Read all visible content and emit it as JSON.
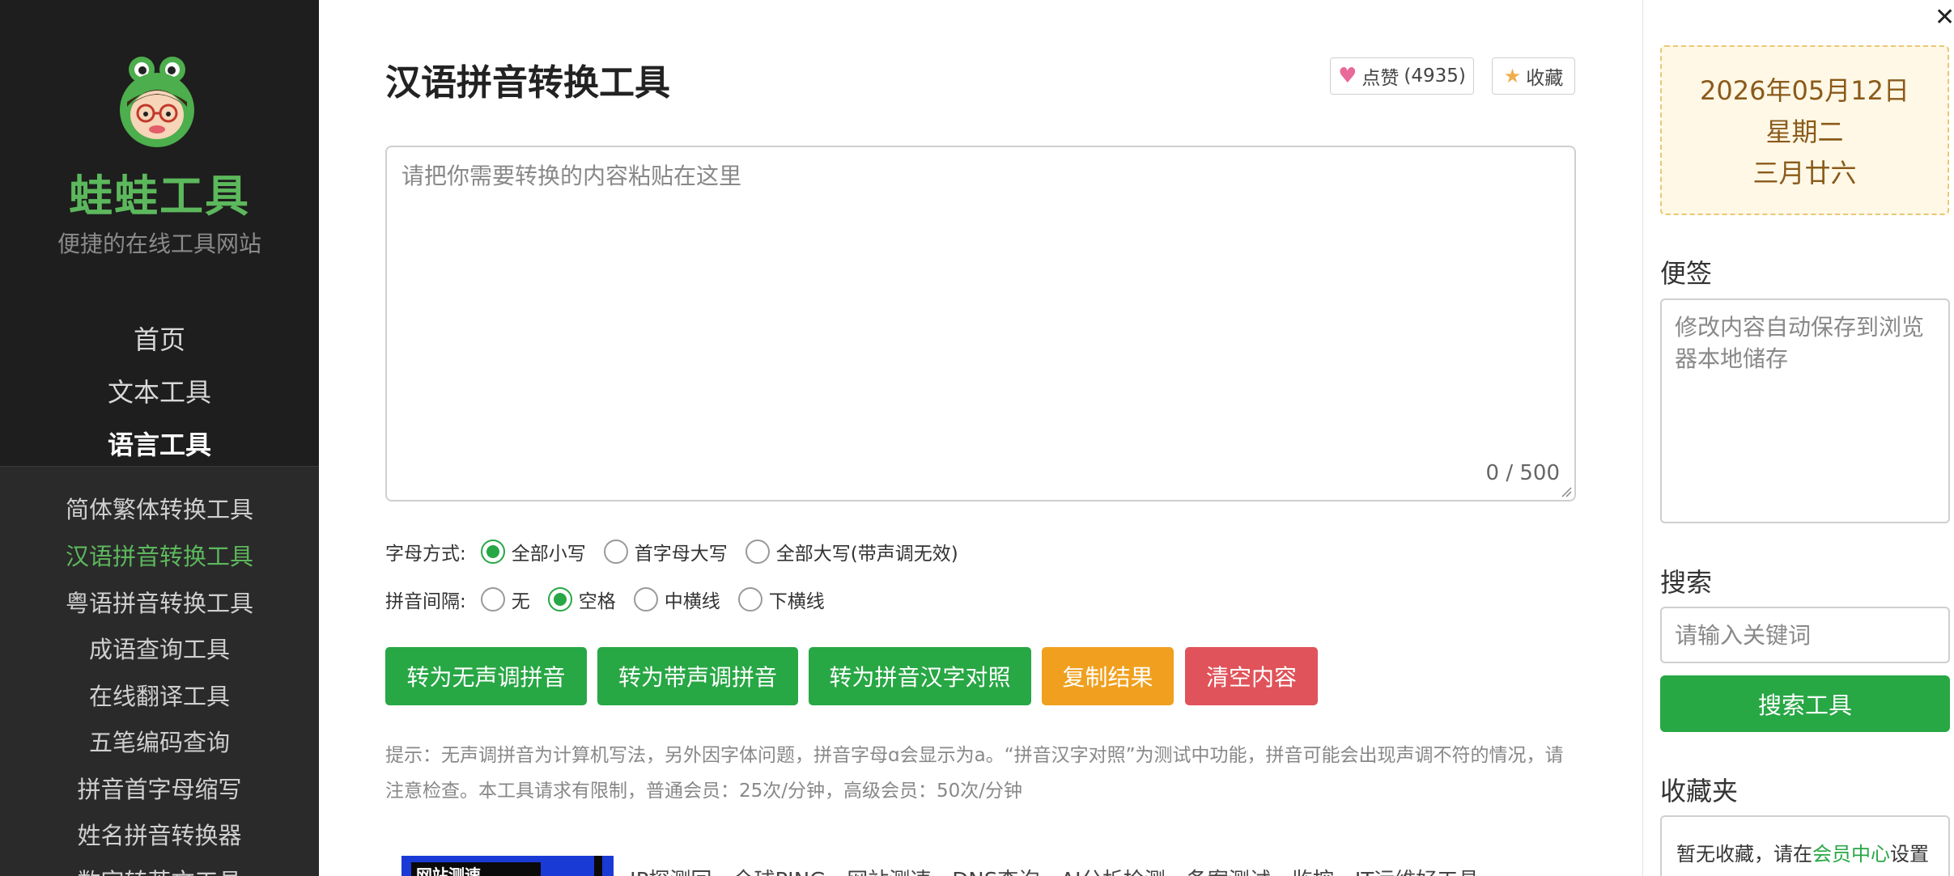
{
  "sidebar": {
    "brand": "蛙蛙工具",
    "slogan": "便捷的在线工具网站",
    "nav": [
      {
        "label": "首页"
      },
      {
        "label": "文本工具"
      },
      {
        "label": "语言工具"
      }
    ],
    "subnav": [
      {
        "label": "简体繁体转换工具"
      },
      {
        "label": "汉语拼音转换工具"
      },
      {
        "label": "粤语拼音转换工具"
      },
      {
        "label": "成语查询工具"
      },
      {
        "label": "在线翻译工具"
      },
      {
        "label": "五笔编码查询"
      },
      {
        "label": "拼音首字母缩写"
      },
      {
        "label": "姓名拼音转换器"
      },
      {
        "label": "数字转英文工具"
      }
    ]
  },
  "main": {
    "title": "汉语拼音转换工具",
    "like": {
      "label": "点赞",
      "count": "(4935)"
    },
    "favorite": {
      "label": "收藏"
    },
    "input": {
      "placeholder": "请把你需要转换的内容粘贴在这里",
      "counter": "0 / 500"
    },
    "letter_mode": {
      "label": "字母方式:",
      "options": [
        {
          "label": "全部小写",
          "checked": true
        },
        {
          "label": "首字母大写",
          "checked": false
        },
        {
          "label": "全部大写(带声调无效)",
          "checked": false
        }
      ]
    },
    "spacing": {
      "label": "拼音间隔:",
      "options": [
        {
          "label": "无",
          "checked": false
        },
        {
          "label": "空格",
          "checked": true
        },
        {
          "label": "中横线",
          "checked": false
        },
        {
          "label": "下横线",
          "checked": false
        }
      ]
    },
    "buttons": {
      "no_tone": "转为无声调拼音",
      "with_tone": "转为带声调拼音",
      "compare": "转为拼音汉字对照",
      "copy": "复制结果",
      "clear": "清空内容"
    },
    "tip": "提示：无声调拼音为计算机写法，另外因字体问题，拼音字母ɑ会显示为a。“拼音汉字对照”为测试中功能，拼音可能会出现声调不符的情况，请注意检查。本工具请求有限制，普通会员：25次/分钟，高级会员：50次/分钟",
    "banner": {
      "image_text": "网站测速",
      "text": "IP探测回、全球PING、网站测速、DNS查询、AI分析检测、备案测试、监控、IT运维好工具"
    }
  },
  "right": {
    "date": {
      "line1": "2026年05月12日",
      "line2": "星期二",
      "line3": "三月廿六"
    },
    "note": {
      "title": "便签",
      "placeholder": "修改内容自动保存到浏览器本地储存"
    },
    "search": {
      "title": "搜索",
      "placeholder": "请输入关键词",
      "button": "搜索工具"
    },
    "favorites": {
      "title": "收藏夹",
      "prefix": "暂无收藏，请在",
      "link": "会员中心",
      "suffix": "设置"
    }
  },
  "colors": {
    "accent_green": "#28a745",
    "brand_green": "#5cb85c",
    "orange": "#f0a01e",
    "red": "#e0535a",
    "sidebar_bg": "#1e1e1e"
  },
  "icons": {
    "like": "heart-icon",
    "favorite": "star-icon",
    "close": "close-icon",
    "logo": "frog-logo-icon"
  }
}
